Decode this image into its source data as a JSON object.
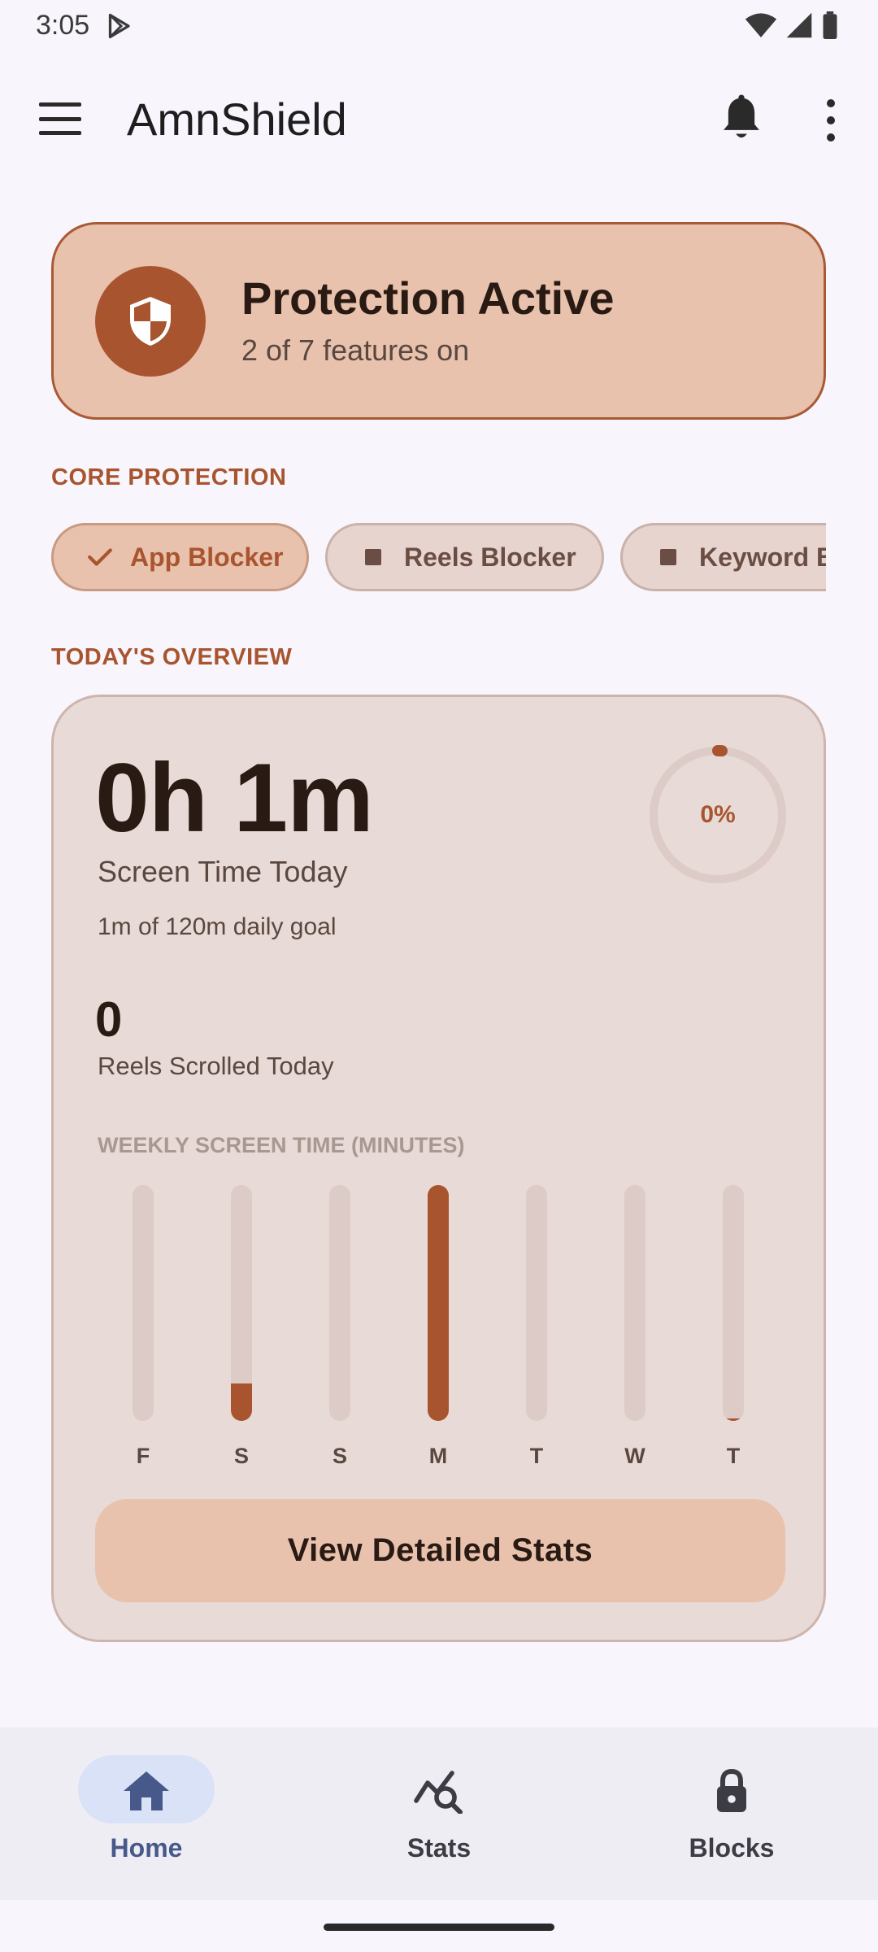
{
  "status_bar": {
    "time": "3:05"
  },
  "app_bar": {
    "title": "AmnShield"
  },
  "protection": {
    "title": "Protection Active",
    "subtitle": "2 of 7 features on"
  },
  "core_protection": {
    "label": "CORE PROTECTION",
    "chips": [
      {
        "label": "App Blocker",
        "active": true
      },
      {
        "label": "Reels Blocker",
        "active": false
      },
      {
        "label": "Keyword B",
        "active": false
      }
    ]
  },
  "overview": {
    "label": "TODAY'S OVERVIEW",
    "screen_time": "0h 1m",
    "screen_time_label": "Screen Time Today",
    "goal_text": "1m of 120m daily goal",
    "progress_label": "0%",
    "progress_fraction": 0.01,
    "reels_value": "0",
    "reels_label": "Reels Scrolled Today",
    "weekly_label": "WEEKLY SCREEN TIME (MINUTES)",
    "stats_button": "View Detailed Stats"
  },
  "chart_data": {
    "type": "bar",
    "categories": [
      "F",
      "S",
      "S",
      "M",
      "T",
      "W",
      "T"
    ],
    "values": [
      0,
      16,
      0,
      100,
      0,
      0,
      1
    ],
    "ylim": [
      0,
      100
    ],
    "title": "WEEKLY SCREEN TIME (MINUTES)",
    "xlabel": "",
    "ylabel": "",
    "grid": false
  },
  "bottom_nav": {
    "items": [
      {
        "label": "Home",
        "icon": "home-icon",
        "active": true
      },
      {
        "label": "Stats",
        "icon": "stats-search-icon",
        "active": false
      },
      {
        "label": "Blocks",
        "icon": "lock-icon",
        "active": false
      }
    ]
  },
  "colors": {
    "accent": "#a8552f",
    "card_bg": "#e8c2ad",
    "overview_bg": "#e8dad6",
    "nav_active": "#46598a"
  }
}
